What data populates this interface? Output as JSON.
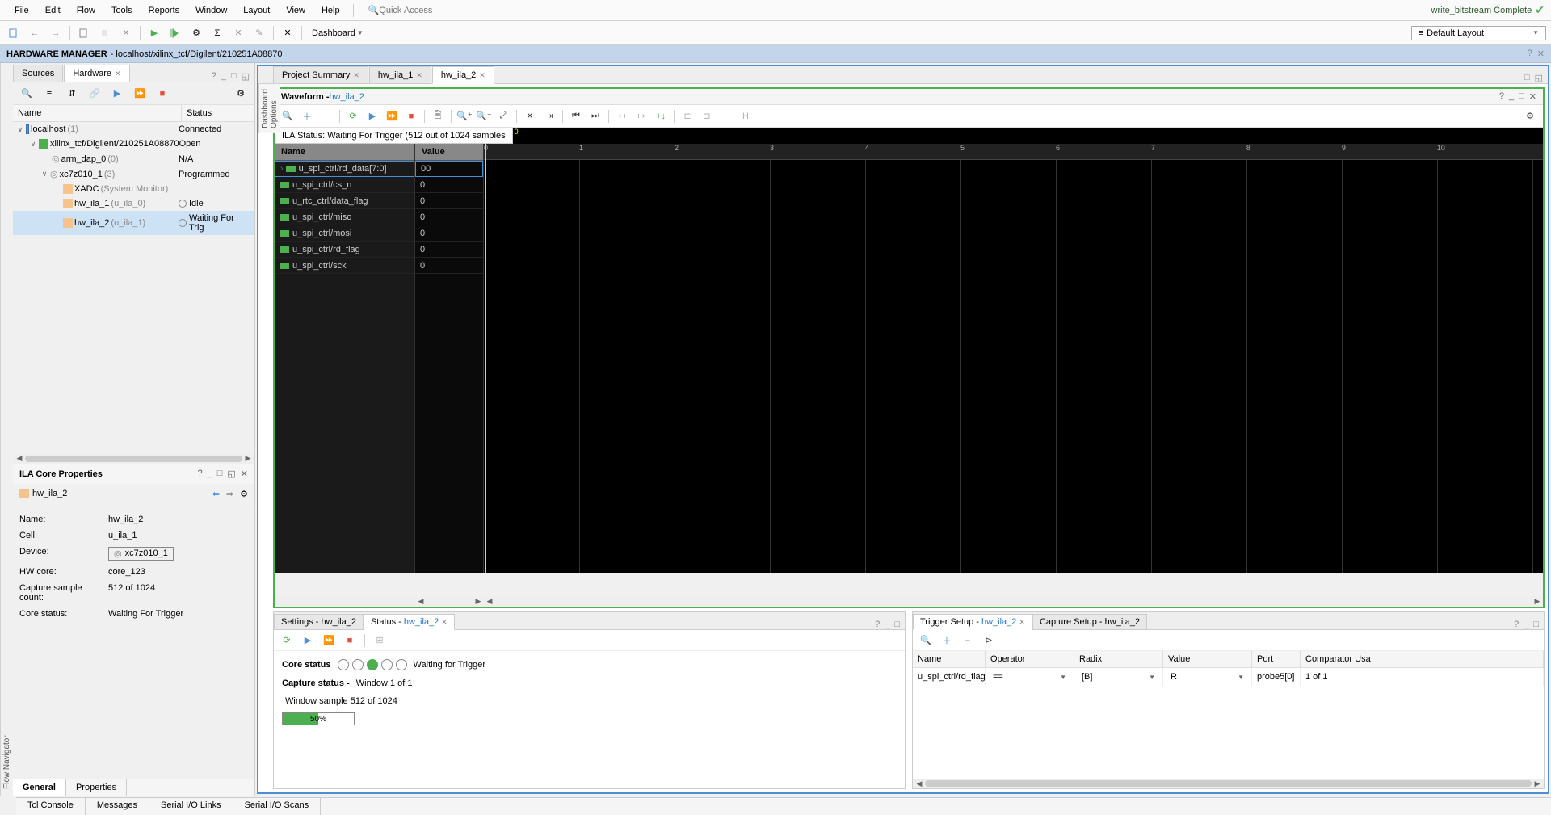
{
  "menus": [
    "File",
    "Edit",
    "Flow",
    "Tools",
    "Reports",
    "Window",
    "Layout",
    "View",
    "Help"
  ],
  "quick_access_placeholder": "Quick Access",
  "build_status": "write_bitstream Complete",
  "dashboard_label": "Dashboard",
  "layout_label": "Default Layout",
  "hw_manager_title": "HARDWARE MANAGER",
  "hw_manager_path": "- localhost/xilinx_tcf/Digilent/210251A08870",
  "flow_nav": "Flow Navigator",
  "dash_options": "Dashboard Options",
  "left_tabs": {
    "sources": "Sources",
    "hardware": "Hardware"
  },
  "tree": {
    "cols": {
      "name": "Name",
      "status": "Status"
    },
    "localhost": {
      "label": "localhost",
      "count": "(1)",
      "status": "Connected"
    },
    "digilent": {
      "label": "xilinx_tcf/Digilent/210251A08870",
      "status": "Open"
    },
    "xc7": {
      "label": "xc7z010_1",
      "count": "(3)",
      "status": "Programmed"
    },
    "arm": {
      "label": "arm_dap_0",
      "count": "(0)",
      "status": "N/A"
    },
    "xadc": {
      "label": "XADC",
      "note": "(System Monitor)"
    },
    "ila1": {
      "label": "hw_ila_1",
      "note": "(u_ila_0)",
      "status": "Idle"
    },
    "ila2": {
      "label": "hw_ila_2",
      "note": "(u_ila_1)",
      "status": "Waiting For Trig"
    }
  },
  "props": {
    "title": "ILA Core Properties",
    "name": "hw_ila_2",
    "rows": {
      "name": {
        "label": "Name:",
        "val": "hw_ila_2"
      },
      "cell": {
        "label": "Cell:",
        "val": "u_ila_1"
      },
      "device": {
        "label": "Device:",
        "val": "xc7z010_1"
      },
      "hwcore": {
        "label": "HW core:",
        "val": "core_123"
      },
      "capcount": {
        "label": "Capture sample count:",
        "val": "512 of 1024"
      },
      "corestat": {
        "label": "Core status:",
        "val": "Waiting For Trigger"
      }
    },
    "tabs": {
      "general": "General",
      "props": "Properties"
    }
  },
  "editor_tabs": {
    "summary": "Project Summary",
    "ila1": "hw_ila_1",
    "ila2": "hw_ila_2"
  },
  "waveform": {
    "title": "Waveform - ",
    "link": "hw_ila_2",
    "status": "ILA Status: Waiting For Trigger (512 out of 1024 samples",
    "cols": {
      "name": "Name",
      "value": "Value"
    },
    "signals": [
      {
        "name": "u_spi_ctrl/rd_data[7:0]",
        "val": "00"
      },
      {
        "name": "u_spi_ctrl/cs_n",
        "val": "0"
      },
      {
        "name": "u_rtc_ctrl/data_flag",
        "val": "0"
      },
      {
        "name": "u_spi_ctrl/miso",
        "val": "0"
      },
      {
        "name": "u_spi_ctrl/mosi",
        "val": "0"
      },
      {
        "name": "u_spi_ctrl/rd_flag",
        "val": "0"
      },
      {
        "name": "u_spi_ctrl/sck",
        "val": "0"
      }
    ],
    "ticks": [
      "0",
      "1",
      "2",
      "3",
      "4",
      "5",
      "6",
      "7",
      "8",
      "9",
      "10"
    ],
    "cursor_label": "0"
  },
  "status_panel": {
    "settings_tab": "Settings - hw_ila_2",
    "status_tab": "Status - ",
    "status_link": "hw_ila_2",
    "core_status_label": "Core status",
    "core_status_text": "Waiting for Trigger",
    "capture_label": "Capture status - ",
    "window_text": "Window 1 of 1",
    "sample_text": "Window sample 512 of 1024",
    "progress": "50%"
  },
  "trigger_panel": {
    "trigger_tab": "Trigger Setup - ",
    "trigger_link": "hw_ila_2",
    "capture_tab": "Capture Setup - hw_ila_2",
    "cols": {
      "name": "Name",
      "op": "Operator",
      "radix": "Radix",
      "value": "Value",
      "port": "Port",
      "comp": "Comparator Usa"
    },
    "row": {
      "name": "u_spi_ctrl/rd_flag",
      "op": "==",
      "radix": "[B]",
      "value": "R",
      "port": "probe5[0]",
      "comp": "1 of 1"
    }
  },
  "footer_tabs": [
    "Tcl Console",
    "Messages",
    "Serial I/O Links",
    "Serial I/O Scans"
  ]
}
